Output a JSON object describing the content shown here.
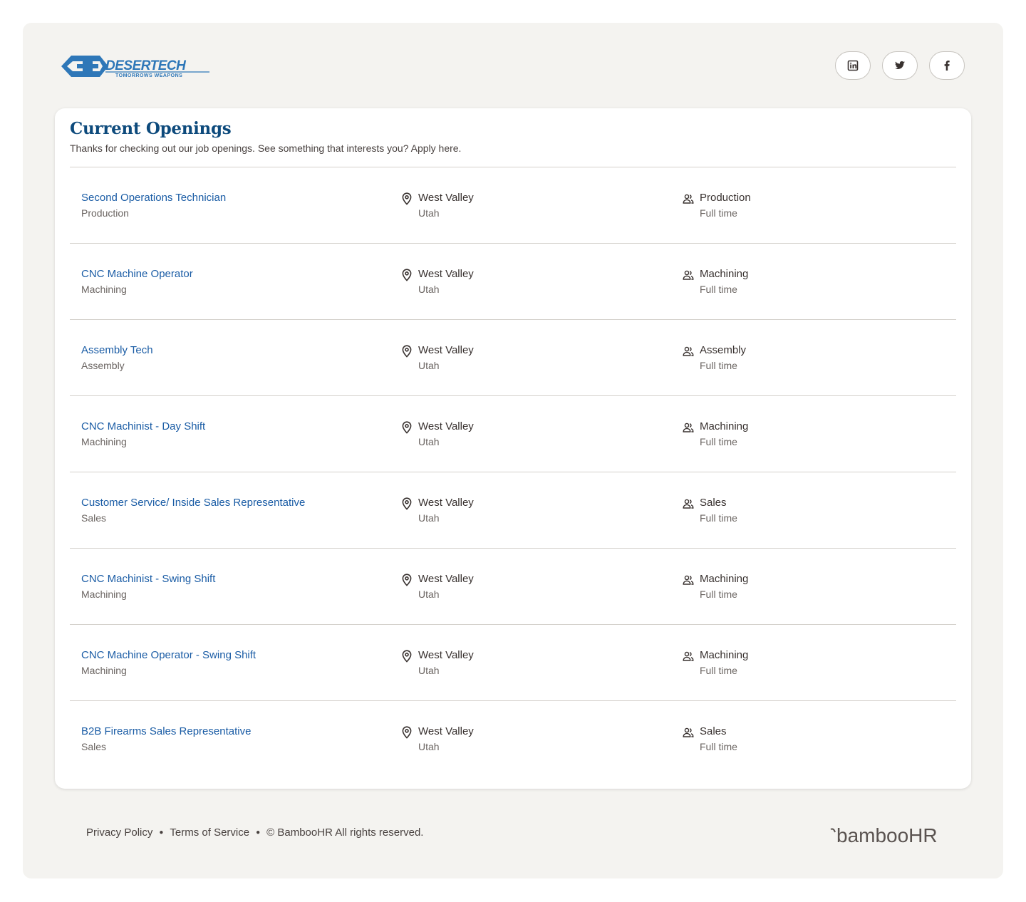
{
  "brand": {
    "logo_text": "DESERTECH",
    "logo_tagline": "TOMORROWS WEAPONS",
    "color": "#2e77b8"
  },
  "social": [
    {
      "name": "linkedin-icon"
    },
    {
      "name": "twitter-icon"
    },
    {
      "name": "facebook-icon"
    }
  ],
  "openings": {
    "title": "Current Openings",
    "subtitle": "Thanks for checking out our job openings. See something that interests you? Apply here.",
    "jobs": [
      {
        "title": "Second Operations Technician",
        "department": "Production",
        "city": "West Valley",
        "state": "Utah",
        "team": "Production",
        "type": "Full time"
      },
      {
        "title": "CNC Machine Operator",
        "department": "Machining",
        "city": "West Valley",
        "state": "Utah",
        "team": "Machining",
        "type": "Full time"
      },
      {
        "title": "Assembly Tech",
        "department": "Assembly",
        "city": "West Valley",
        "state": "Utah",
        "team": "Assembly",
        "type": "Full time"
      },
      {
        "title": "CNC Machinist - Day Shift",
        "department": "Machining",
        "city": "West Valley",
        "state": "Utah",
        "team": "Machining",
        "type": "Full time"
      },
      {
        "title": "Customer Service/ Inside Sales Representative",
        "department": "Sales",
        "city": "West Valley",
        "state": "Utah",
        "team": "Sales",
        "type": "Full time"
      },
      {
        "title": "CNC Machinist - Swing Shift",
        "department": "Machining",
        "city": "West Valley",
        "state": "Utah",
        "team": "Machining",
        "type": "Full time"
      },
      {
        "title": "CNC Machine Operator - Swing Shift",
        "department": "Machining",
        "city": "West Valley",
        "state": "Utah",
        "team": "Machining",
        "type": "Full time"
      },
      {
        "title": "B2B Firearms Sales Representative",
        "department": "Sales",
        "city": "West Valley",
        "state": "Utah",
        "team": "Sales",
        "type": "Full time"
      }
    ]
  },
  "footer": {
    "privacy": "Privacy Policy",
    "terms": "Terms of Service",
    "copyright": "© BambooHR All rights reserved.",
    "bamboo_logo": "bambooHR"
  },
  "colors": {
    "heading": "#0d4a7c",
    "link": "#1a5ca5",
    "background": "#f4f3f0"
  }
}
